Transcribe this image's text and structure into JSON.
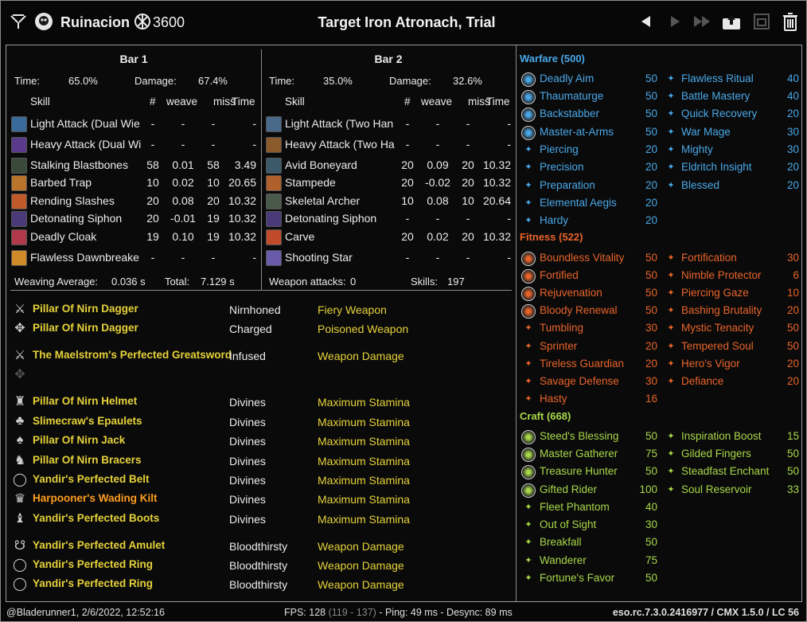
{
  "title_bar": {
    "character": "Ruinacion",
    "cp": "3600",
    "fight_title": "Target Iron Atronach, Trial"
  },
  "bars": [
    {
      "header": "Bar 1",
      "time_label": "Time:",
      "time": "65.0%",
      "damage_label": "Damage:",
      "damage": "67.4%",
      "columns": [
        "Skill",
        "#",
        "weave",
        "miss",
        "Time"
      ],
      "rows": [
        {
          "skill": "Light Attack (Dual Wie",
          "n": "-",
          "weave": "-",
          "miss": "-",
          "time": "-",
          "icon_color": "#3a6a9a"
        },
        {
          "skill": "Heavy Attack (Dual Wi",
          "n": "-",
          "weave": "-",
          "miss": "-",
          "time": "-",
          "icon_color": "#5a3a8a"
        },
        {
          "skill": "Stalking Blastbones",
          "n": "58",
          "weave": "0.01",
          "miss": "58",
          "time": "3.49",
          "icon_color": "#3a4a3a"
        },
        {
          "skill": "Barbed Trap",
          "n": "10",
          "weave": "0.02",
          "miss": "10",
          "time": "20.65",
          "icon_color": "#b8742a"
        },
        {
          "skill": "Rending Slashes",
          "n": "20",
          "weave": "0.08",
          "miss": "20",
          "time": "10.32",
          "icon_color": "#c05a2a"
        },
        {
          "skill": "Detonating Siphon",
          "n": "20",
          "weave": "-0.01",
          "miss": "19",
          "time": "10.32",
          "icon_color": "#4a3a7a"
        },
        {
          "skill": "Deadly Cloak",
          "n": "19",
          "weave": "0.10",
          "miss": "19",
          "time": "10.32",
          "icon_color": "#b03a4a"
        },
        {
          "skill": "Flawless Dawnbreake",
          "n": "-",
          "weave": "-",
          "miss": "-",
          "time": "-",
          "icon_color": "#d08a2a"
        }
      ],
      "footer_left_label": "Weaving Average:",
      "footer_left_value": "0.036 s",
      "footer_right_label": "Total:",
      "footer_right_value": "7.129 s"
    },
    {
      "header": "Bar 2",
      "time_label": "Time:",
      "time": "35.0%",
      "damage_label": "Damage:",
      "damage": "32.6%",
      "columns": [
        "Skill",
        "#",
        "weave",
        "miss",
        "Time"
      ],
      "rows": [
        {
          "skill": "Light Attack (Two Han",
          "n": "-",
          "weave": "-",
          "miss": "-",
          "time": "-",
          "icon_color": "#4a6a8a"
        },
        {
          "skill": "Heavy Attack (Two Ha",
          "n": "-",
          "weave": "-",
          "miss": "-",
          "time": "-",
          "icon_color": "#8a5a2a"
        },
        {
          "skill": "Avid Boneyard",
          "n": "20",
          "weave": "0.09",
          "miss": "20",
          "time": "10.32",
          "icon_color": "#3a5a6a"
        },
        {
          "skill": "Stampede",
          "n": "20",
          "weave": "-0.02",
          "miss": "20",
          "time": "10.32",
          "icon_color": "#b0602a"
        },
        {
          "skill": "Skeletal Archer",
          "n": "10",
          "weave": "0.08",
          "miss": "10",
          "time": "20.64",
          "icon_color": "#4a5a4a"
        },
        {
          "skill": "Detonating Siphon",
          "n": "-",
          "weave": "-",
          "miss": "-",
          "time": "-",
          "icon_color": "#4a3a7a"
        },
        {
          "skill": "Carve",
          "n": "20",
          "weave": "0.02",
          "miss": "20",
          "time": "10.32",
          "icon_color": "#c04a2a"
        },
        {
          "skill": "Shooting Star",
          "n": "-",
          "weave": "-",
          "miss": "-",
          "time": "-",
          "icon_color": "#6a5aaa"
        }
      ],
      "footer_left_label": "Weapon attacks:",
      "footer_left_value": "0",
      "footer_right_label": "Skills:",
      "footer_right_value": "197"
    }
  ],
  "gear": [
    {
      "name": "Pillar Of Nirn Dagger",
      "trait": "Nirnhoned",
      "enchant": "Fiery Weapon",
      "icon": "dagger-icon",
      "glyph": "⚔",
      "orange": false
    },
    {
      "name": "Pillar Of Nirn Dagger",
      "trait": "Charged",
      "enchant": "Poisoned Weapon",
      "icon": "dagger-icon",
      "glyph": "✥",
      "orange": false
    },
    {
      "name": "The Maelstrom's Perfected Greatsword",
      "trait": "Infused",
      "enchant": "Weapon Damage",
      "icon": "greatsword-icon",
      "glyph": "⚔",
      "orange": false
    },
    {
      "name": "Pillar Of Nirn Helmet",
      "trait": "Divines",
      "enchant": "Maximum Stamina",
      "icon": "helmet-icon",
      "glyph": "♜",
      "orange": false
    },
    {
      "name": "Slimecraw's Epaulets",
      "trait": "Divines",
      "enchant": "Maximum Stamina",
      "icon": "shoulder-icon",
      "glyph": "♣",
      "orange": false
    },
    {
      "name": "Pillar Of Nirn Jack",
      "trait": "Divines",
      "enchant": "Maximum Stamina",
      "icon": "chest-icon",
      "glyph": "♠",
      "orange": false
    },
    {
      "name": "Pillar Of Nirn Bracers",
      "trait": "Divines",
      "enchant": "Maximum Stamina",
      "icon": "bracers-icon",
      "glyph": "♞",
      "orange": false
    },
    {
      "name": "Yandir's Perfected Belt",
      "trait": "Divines",
      "enchant": "Maximum Stamina",
      "icon": "belt-icon",
      "glyph": "◯",
      "orange": false
    },
    {
      "name": "Harpooner's Wading Kilt",
      "trait": "Divines",
      "enchant": "Maximum Stamina",
      "icon": "legs-icon",
      "glyph": "♛",
      "orange": true
    },
    {
      "name": "Yandir's Perfected Boots",
      "trait": "Divines",
      "enchant": "Maximum Stamina",
      "icon": "boots-icon",
      "glyph": "♝",
      "orange": false
    },
    {
      "name": "Yandir's Perfected Amulet",
      "trait": "Bloodthirsty",
      "enchant": "Weapon Damage",
      "icon": "amulet-icon",
      "glyph": "☋",
      "orange": false
    },
    {
      "name": "Yandir's Perfected Ring",
      "trait": "Bloodthirsty",
      "enchant": "Weapon Damage",
      "icon": "ring-icon",
      "glyph": "◯",
      "orange": false
    },
    {
      "name": "Yandir's Perfected Ring",
      "trait": "Bloodthirsty",
      "enchant": "Weapon Damage",
      "icon": "ring-icon",
      "glyph": "◯",
      "orange": false
    }
  ],
  "cp": {
    "colors": {
      "warfare": "#4aa8e8",
      "fitness": "#e8642a",
      "craft": "#a8d84a"
    },
    "warfare": {
      "header": "Warfare (500)",
      "left": [
        {
          "name": "Deadly Aim",
          "value": "50",
          "slotted": true
        },
        {
          "name": "Thaumaturge",
          "value": "50",
          "slotted": true
        },
        {
          "name": "Backstabber",
          "value": "50",
          "slotted": true
        },
        {
          "name": "Master-at-Arms",
          "value": "50",
          "slotted": true
        },
        {
          "name": "Piercing",
          "value": "20",
          "slotted": false
        },
        {
          "name": "Precision",
          "value": "20",
          "slotted": false
        },
        {
          "name": "Preparation",
          "value": "20",
          "slotted": false
        },
        {
          "name": "Elemental Aegis",
          "value": "20",
          "slotted": false
        },
        {
          "name": "Hardy",
          "value": "20",
          "slotted": false
        }
      ],
      "right": [
        {
          "name": "Flawless Ritual",
          "value": "40"
        },
        {
          "name": "Battle Mastery",
          "value": "40"
        },
        {
          "name": "Quick Recovery",
          "value": "20"
        },
        {
          "name": "War Mage",
          "value": "30"
        },
        {
          "name": "Mighty",
          "value": "30"
        },
        {
          "name": "Eldritch Insight",
          "value": "20"
        },
        {
          "name": "Blessed",
          "value": "20"
        }
      ]
    },
    "fitness": {
      "header": "Fitness (522)",
      "left": [
        {
          "name": "Boundless Vitality",
          "value": "50",
          "slotted": true
        },
        {
          "name": "Fortified",
          "value": "50",
          "slotted": true
        },
        {
          "name": "Rejuvenation",
          "value": "50",
          "slotted": true
        },
        {
          "name": "Bloody Renewal",
          "value": "50",
          "slotted": true
        },
        {
          "name": "Tumbling",
          "value": "30",
          "slotted": false
        },
        {
          "name": "Sprinter",
          "value": "20",
          "slotted": false
        },
        {
          "name": "Tireless Guardian",
          "value": "20",
          "slotted": false
        },
        {
          "name": "Savage Defense",
          "value": "30",
          "slotted": false
        },
        {
          "name": "Hasty",
          "value": "16",
          "slotted": false
        }
      ],
      "right": [
        {
          "name": "Fortification",
          "value": "30"
        },
        {
          "name": "Nimble Protector",
          "value": "6"
        },
        {
          "name": "Piercing Gaze",
          "value": "10"
        },
        {
          "name": "Bashing Brutality",
          "value": "20"
        },
        {
          "name": "Mystic Tenacity",
          "value": "50"
        },
        {
          "name": "Tempered Soul",
          "value": "50"
        },
        {
          "name": "Hero's Vigor",
          "value": "20"
        },
        {
          "name": "Defiance",
          "value": "20"
        }
      ]
    },
    "craft": {
      "header": "Craft (668)",
      "left": [
        {
          "name": "Steed's Blessing",
          "value": "50",
          "slotted": true
        },
        {
          "name": "Master Gatherer",
          "value": "75",
          "slotted": true
        },
        {
          "name": "Treasure Hunter",
          "value": "50",
          "slotted": true
        },
        {
          "name": "Gifted Rider",
          "value": "100",
          "slotted": true
        },
        {
          "name": "Fleet Phantom",
          "value": "40",
          "slotted": false
        },
        {
          "name": "Out of Sight",
          "value": "30",
          "slotted": false
        },
        {
          "name": "Breakfall",
          "value": "50",
          "slotted": false
        },
        {
          "name": "Wanderer",
          "value": "75",
          "slotted": false
        },
        {
          "name": "Fortune's Favor",
          "value": "50",
          "slotted": false
        }
      ],
      "right": [
        {
          "name": "Inspiration Boost",
          "value": "15"
        },
        {
          "name": "Gilded Fingers",
          "value": "50"
        },
        {
          "name": "Steadfast Enchant",
          "value": "50"
        },
        {
          "name": "Soul Reservoir",
          "value": "33"
        }
      ]
    }
  },
  "footer": {
    "user_time": "@Bladerunner1, 2/6/2022, 12:52:16",
    "fps_label": "FPS: 128",
    "fps_range": "(119 - 137)",
    "ping_desync": "- Ping: 49 ms - Desync: 89 ms",
    "version": "eso.rc.7.3.0.2416977 / CMX 1.5.0 / LC 56"
  }
}
